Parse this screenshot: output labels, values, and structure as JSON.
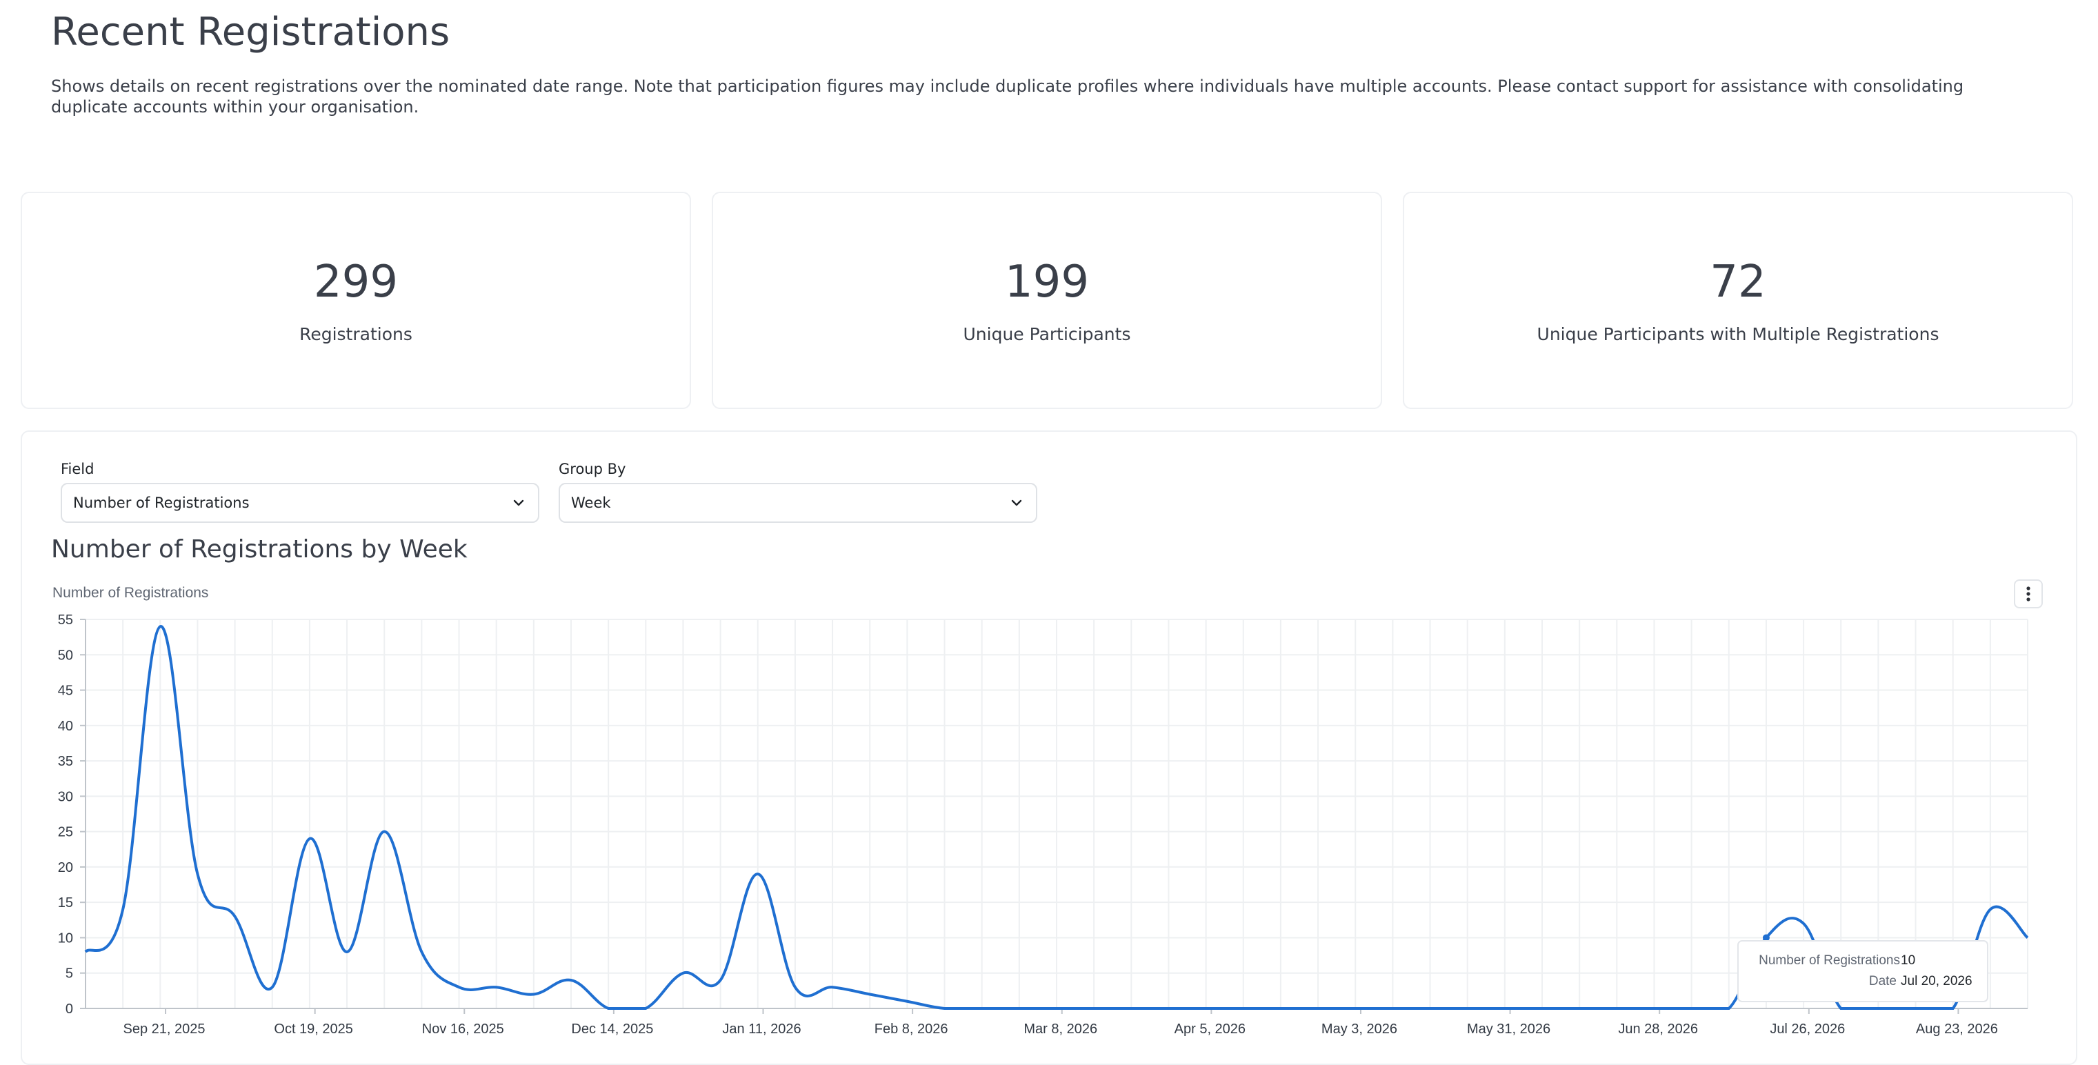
{
  "page": {
    "title": "Recent Registrations",
    "description": "Shows details on recent registrations over the nominated date range. Note that participation figures may include duplicate profiles where individuals have multiple accounts. Please contact support for assistance with consolidating duplicate accounts within your organisation."
  },
  "stats": [
    {
      "value": "299",
      "label": "Registrations"
    },
    {
      "value": "199",
      "label": "Unique Participants"
    },
    {
      "value": "72",
      "label": "Unique Participants with Multiple Registrations"
    }
  ],
  "controls": {
    "field_label": "Field",
    "field_value": "Number of Registrations",
    "groupby_label": "Group By",
    "groupby_value": "Week"
  },
  "chart_title": "Number of Registrations by Week",
  "icons": {
    "dropdown": "chevron-down-icon",
    "menu": "more-vertical-icon"
  },
  "colors": {
    "line": "#1f6fd1",
    "grid": "#eef0f2",
    "axis": "#bfc4ca"
  },
  "tooltip": {
    "label1": "Number of Registrations",
    "value1": "10",
    "label2": "Date",
    "value2": "Jul 20, 2026"
  },
  "chart_data": {
    "type": "line",
    "ylabel": "Number of Registrations",
    "ylim": [
      0,
      55
    ],
    "yticks": [
      0,
      5,
      10,
      15,
      20,
      25,
      30,
      35,
      40,
      45,
      50,
      55
    ],
    "xtick_labels": [
      "Sep 21, 2025",
      "Oct 19, 2025",
      "Nov 16, 2025",
      "Dec 14, 2025",
      "Jan 11, 2026",
      "Feb 8, 2026",
      "Mar 8, 2026",
      "Apr 5, 2026",
      "May 3, 2026",
      "May 31, 2026",
      "Jun 28, 2026",
      "Jul 26, 2026",
      "Aug 23, 2026"
    ],
    "grid": true,
    "series": [
      {
        "x": [
          "Sep 8, 2025",
          "Sep 15, 2025",
          "Sep 22, 2025",
          "Sep 29, 2025",
          "Oct 6, 2025",
          "Oct 13, 2025",
          "Oct 20, 2025",
          "Oct 27, 2025",
          "Nov 3, 2025",
          "Nov 10, 2025",
          "Nov 17, 2025",
          "Nov 24, 2025",
          "Dec 1, 2025",
          "Dec 8, 2025",
          "Dec 15, 2025",
          "Dec 22, 2025",
          "Dec 29, 2025",
          "Jan 5, 2026",
          "Jan 12, 2026",
          "Jan 19, 2026",
          "Jan 26, 2026",
          "Feb 2, 2026",
          "Feb 9, 2026",
          "Feb 16, 2026",
          "Feb 23, 2026",
          "Mar 2, 2026",
          "Mar 9, 2026",
          "Mar 16, 2026",
          "Mar 23, 2026",
          "Mar 30, 2026",
          "Apr 6, 2026",
          "Apr 13, 2026",
          "Apr 20, 2026",
          "Apr 27, 2026",
          "May 4, 2026",
          "May 11, 2026",
          "May 18, 2026",
          "May 25, 2026",
          "Jun 1, 2026",
          "Jun 8, 2026",
          "Jun 15, 2026",
          "Jun 22, 2026",
          "Jun 29, 2026",
          "Jul 6, 2026",
          "Jul 13, 2026",
          "Jul 20, 2026",
          "Jul 27, 2026",
          "Aug 3, 2026",
          "Aug 10, 2026",
          "Aug 17, 2026",
          "Aug 24, 2026",
          "Aug 31, 2026",
          "Sep 7, 2026"
        ],
        "values": [
          8,
          14,
          54,
          19,
          13,
          3,
          24,
          8,
          25,
          8,
          3,
          3,
          2,
          4,
          0,
          0,
          5,
          4,
          19,
          3,
          3,
          2,
          1,
          0,
          0,
          0,
          0,
          0,
          0,
          0,
          0,
          0,
          0,
          0,
          0,
          0,
          0,
          0,
          0,
          0,
          0,
          0,
          0,
          0,
          0,
          10,
          12,
          0,
          0,
          0,
          0,
          14,
          10
        ]
      }
    ]
  }
}
